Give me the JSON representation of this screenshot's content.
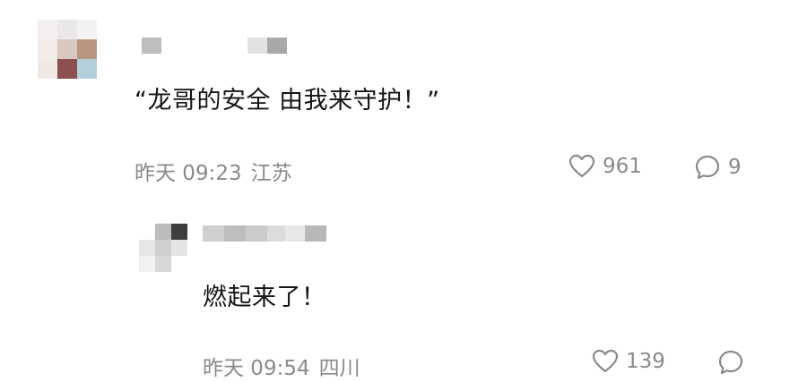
{
  "comments": [
    {
      "text": "“龙哥的安全 由我来守护！”",
      "time": "昨天 09:23",
      "location": "江苏",
      "likes": "961",
      "replies": "9"
    },
    {
      "text": "燃起来了！",
      "time": "昨天 09:54",
      "location": "四川",
      "likes": "139"
    }
  ],
  "icons": {
    "like": "heart-outline-icon",
    "reply": "speech-bubble-icon"
  },
  "colors": {
    "meta_gray": "#8a8a8a",
    "text": "#151515"
  }
}
